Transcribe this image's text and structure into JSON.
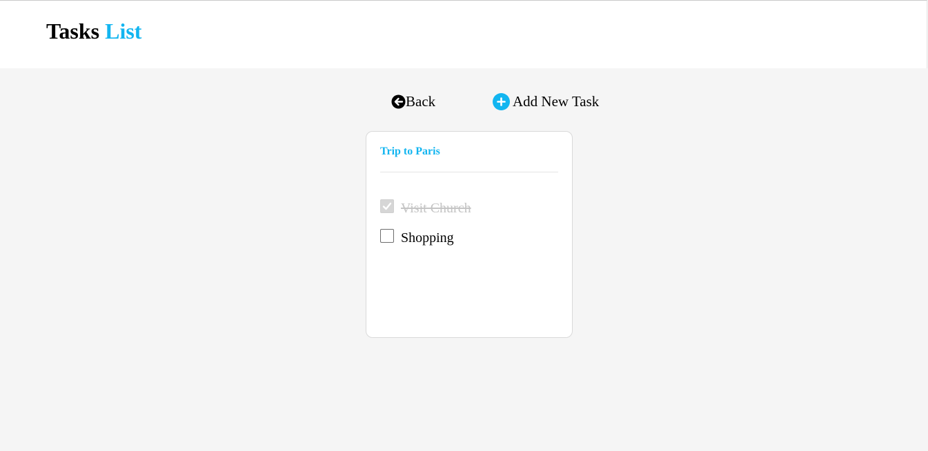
{
  "header": {
    "title_part1": "Tasks",
    "title_part2": "List"
  },
  "actions": {
    "back_label": "Back",
    "back_icon": "arrow-left-circle-icon",
    "add_label": "Add New Task",
    "add_icon": "plus-circle-icon"
  },
  "card": {
    "title": "Trip to Paris",
    "tasks": [
      {
        "label": "Visit Church",
        "checked": true
      },
      {
        "label": "Shopping",
        "checked": false
      }
    ]
  },
  "colors": {
    "accent": "#12b5f0",
    "background": "#f5f5f5",
    "card": "#ffffff",
    "completed_text": "#c4c4c4"
  }
}
